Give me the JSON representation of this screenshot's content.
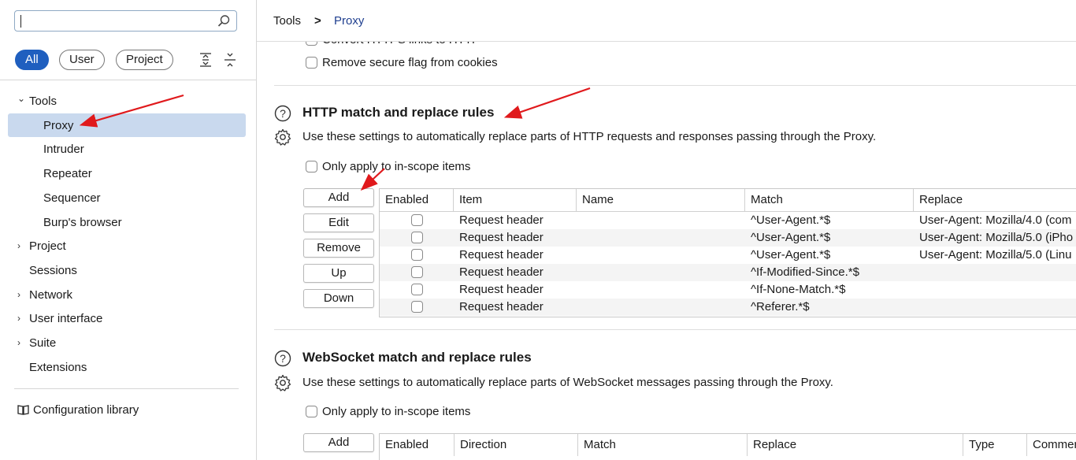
{
  "sidebar": {
    "search": {
      "value": "",
      "placeholder": ""
    },
    "filters": [
      "All",
      "User",
      "Project"
    ],
    "nav": [
      {
        "label": "Tools",
        "chevron": "⌄",
        "indent": 0,
        "selected": false
      },
      {
        "label": "Proxy",
        "chevron": "",
        "indent": 1,
        "selected": true
      },
      {
        "label": "Intruder",
        "chevron": "",
        "indent": 1,
        "selected": false
      },
      {
        "label": "Repeater",
        "chevron": "",
        "indent": 1,
        "selected": false
      },
      {
        "label": "Sequencer",
        "chevron": "",
        "indent": 1,
        "selected": false
      },
      {
        "label": "Burp's browser",
        "chevron": "",
        "indent": 1,
        "selected": false
      },
      {
        "label": "Project",
        "chevron": "›",
        "indent": 0,
        "selected": false
      },
      {
        "label": "Sessions",
        "chevron": "",
        "indent": 0,
        "selected": false
      },
      {
        "label": "Network",
        "chevron": "›",
        "indent": 0,
        "selected": false
      },
      {
        "label": "User interface",
        "chevron": "›",
        "indent": 0,
        "selected": false
      },
      {
        "label": "Suite",
        "chevron": "›",
        "indent": 0,
        "selected": false
      },
      {
        "label": "Extensions",
        "chevron": "",
        "indent": 0,
        "selected": false
      }
    ],
    "config_library": "Configuration library"
  },
  "header": {
    "breadcrumb": [
      "Tools",
      ">",
      "Proxy"
    ]
  },
  "main": {
    "cut_off_option": "Convert HTTPS links to HTTP",
    "remove_secure_flag": "Remove secure flag from cookies",
    "http_section": {
      "title": "HTTP match and replace rules",
      "description": "Use these settings to automatically replace parts of HTTP requests and responses passing through the Proxy.",
      "scope_label": "Only apply to in-scope items",
      "buttons": [
        "Add",
        "Edit",
        "Remove",
        "Up",
        "Down"
      ],
      "columns": [
        "Enabled",
        "Item",
        "Name",
        "Match",
        "Replace"
      ],
      "rows": [
        {
          "enabled": false,
          "item": "Request header",
          "name": "",
          "match": "^User-Agent.*$",
          "replace": "User-Agent: Mozilla/4.0 (com"
        },
        {
          "enabled": false,
          "item": "Request header",
          "name": "",
          "match": "^User-Agent.*$",
          "replace": "User-Agent: Mozilla/5.0 (iPho"
        },
        {
          "enabled": false,
          "item": "Request header",
          "name": "",
          "match": "^User-Agent.*$",
          "replace": "User-Agent: Mozilla/5.0 (Linu"
        },
        {
          "enabled": false,
          "item": "Request header",
          "name": "",
          "match": "^If-Modified-Since.*$",
          "replace": ""
        },
        {
          "enabled": false,
          "item": "Request header",
          "name": "",
          "match": "^If-None-Match.*$",
          "replace": ""
        },
        {
          "enabled": false,
          "item": "Request header",
          "name": "",
          "match": "^Referer.*$",
          "replace": ""
        }
      ]
    },
    "ws_section": {
      "title": "WebSocket match and replace rules",
      "description": "Use these settings to automatically replace parts of WebSocket messages passing through the Proxy.",
      "scope_label": "Only apply to in-scope items",
      "add_button": "Add",
      "columns": [
        "Enabled",
        "Direction",
        "Match",
        "Replace",
        "Type",
        "Commer"
      ]
    }
  },
  "colors": {
    "accent": "#1f5fbf",
    "selection": "#c9d9ee",
    "annotation_arrow": "#e0191c"
  }
}
